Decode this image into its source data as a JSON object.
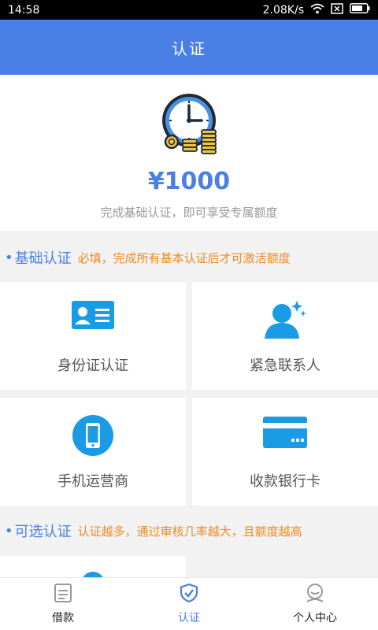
{
  "status_bar": {
    "time": "14:58",
    "network_speed": "2.08K/s"
  },
  "header": {
    "title": "认证"
  },
  "hero": {
    "amount": "¥1000",
    "description": "完成基础认证，即可享受专属额度"
  },
  "basic_section": {
    "bullet": "•",
    "title": "基础认证",
    "note": "必填，完成所有基本认证后才可激活额度"
  },
  "basic_items": [
    {
      "label": "身份证认证",
      "icon": "id-card-icon"
    },
    {
      "label": "紧急联系人",
      "icon": "contact-person-icon"
    },
    {
      "label": "手机运营商",
      "icon": "mobile-phone-icon"
    },
    {
      "label": "收款银行卡",
      "icon": "bank-card-icon"
    }
  ],
  "optional_section": {
    "bullet": "•",
    "title": "可选认证",
    "note": "认证越多，通过审核几率越大，且额度越高"
  },
  "bottom_nav": [
    {
      "label": "借款",
      "icon": "loan-icon",
      "active": false
    },
    {
      "label": "认证",
      "icon": "shield-check-icon",
      "active": true
    },
    {
      "label": "个人中心",
      "icon": "user-center-icon",
      "active": false
    }
  ],
  "colors": {
    "primary": "#4a7fe6",
    "accent": "#f08a24",
    "icon_blue": "#1a9be6"
  }
}
